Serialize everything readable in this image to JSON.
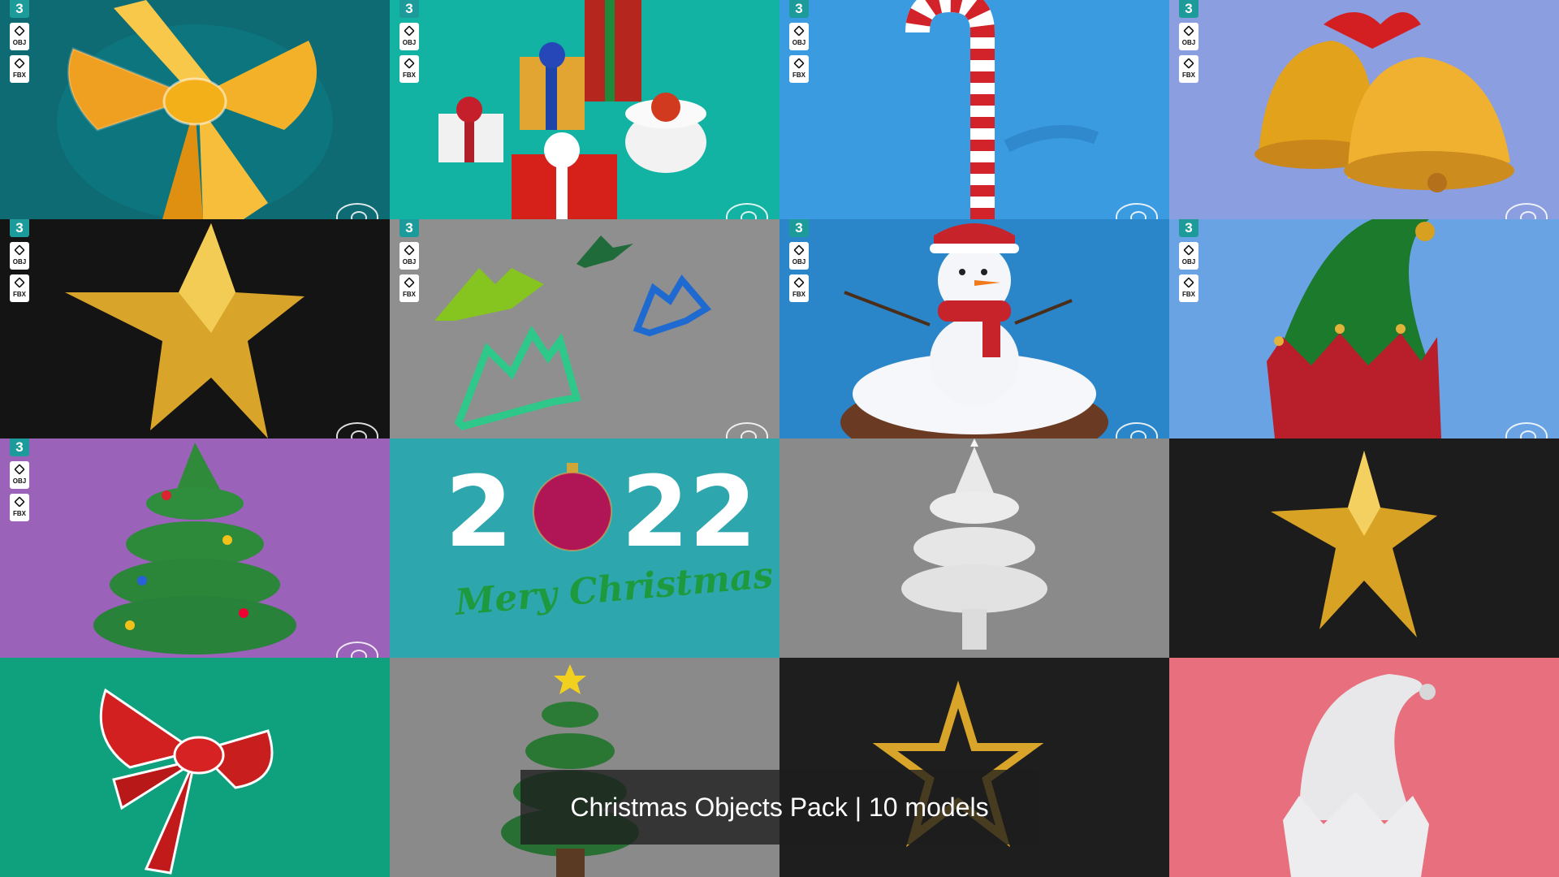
{
  "badges": {
    "three": "3",
    "obj": "OBJ",
    "fbx": "FBX"
  },
  "tile_colors": [
    "#0e6a73",
    "#12b3a2",
    "#3a9be0",
    "#8a9ee0",
    "#141414",
    "#8f8f8f",
    "#2a86c8",
    "#6aa3e3",
    "#9a62b8",
    "#2ea6ae",
    "#8a8a8a",
    "#1c1c1c",
    "#0fa07d",
    "#8a8a8a",
    "#1e1e1e",
    "#e8707e"
  ],
  "tiles": [
    {
      "name": "gold-bow",
      "badges": true
    },
    {
      "name": "gift-boxes",
      "badges": true
    },
    {
      "name": "candy-cane",
      "badges": true
    },
    {
      "name": "gold-bells",
      "badges": true
    },
    {
      "name": "gold-star",
      "badges": true
    },
    {
      "name": "tree-cookie-cutters",
      "badges": true
    },
    {
      "name": "snowman-globe",
      "badges": true
    },
    {
      "name": "elf-hat-green",
      "badges": true
    },
    {
      "name": "christmas-tree-green",
      "badges": true
    },
    {
      "name": "year-2022",
      "badges": false
    },
    {
      "name": "tree-white",
      "badges": false
    },
    {
      "name": "gold-star-small",
      "badges": false
    },
    {
      "name": "red-bow",
      "badges": false
    },
    {
      "name": "tree-star",
      "badges": false
    },
    {
      "name": "star-outline",
      "badges": false
    },
    {
      "name": "elf-hat-white",
      "badges": false
    }
  ],
  "year_text": {
    "left": "2",
    "right": "22"
  },
  "merry_text": "Mery Christmas",
  "caption": "Christmas Objects Pack | 10 models"
}
